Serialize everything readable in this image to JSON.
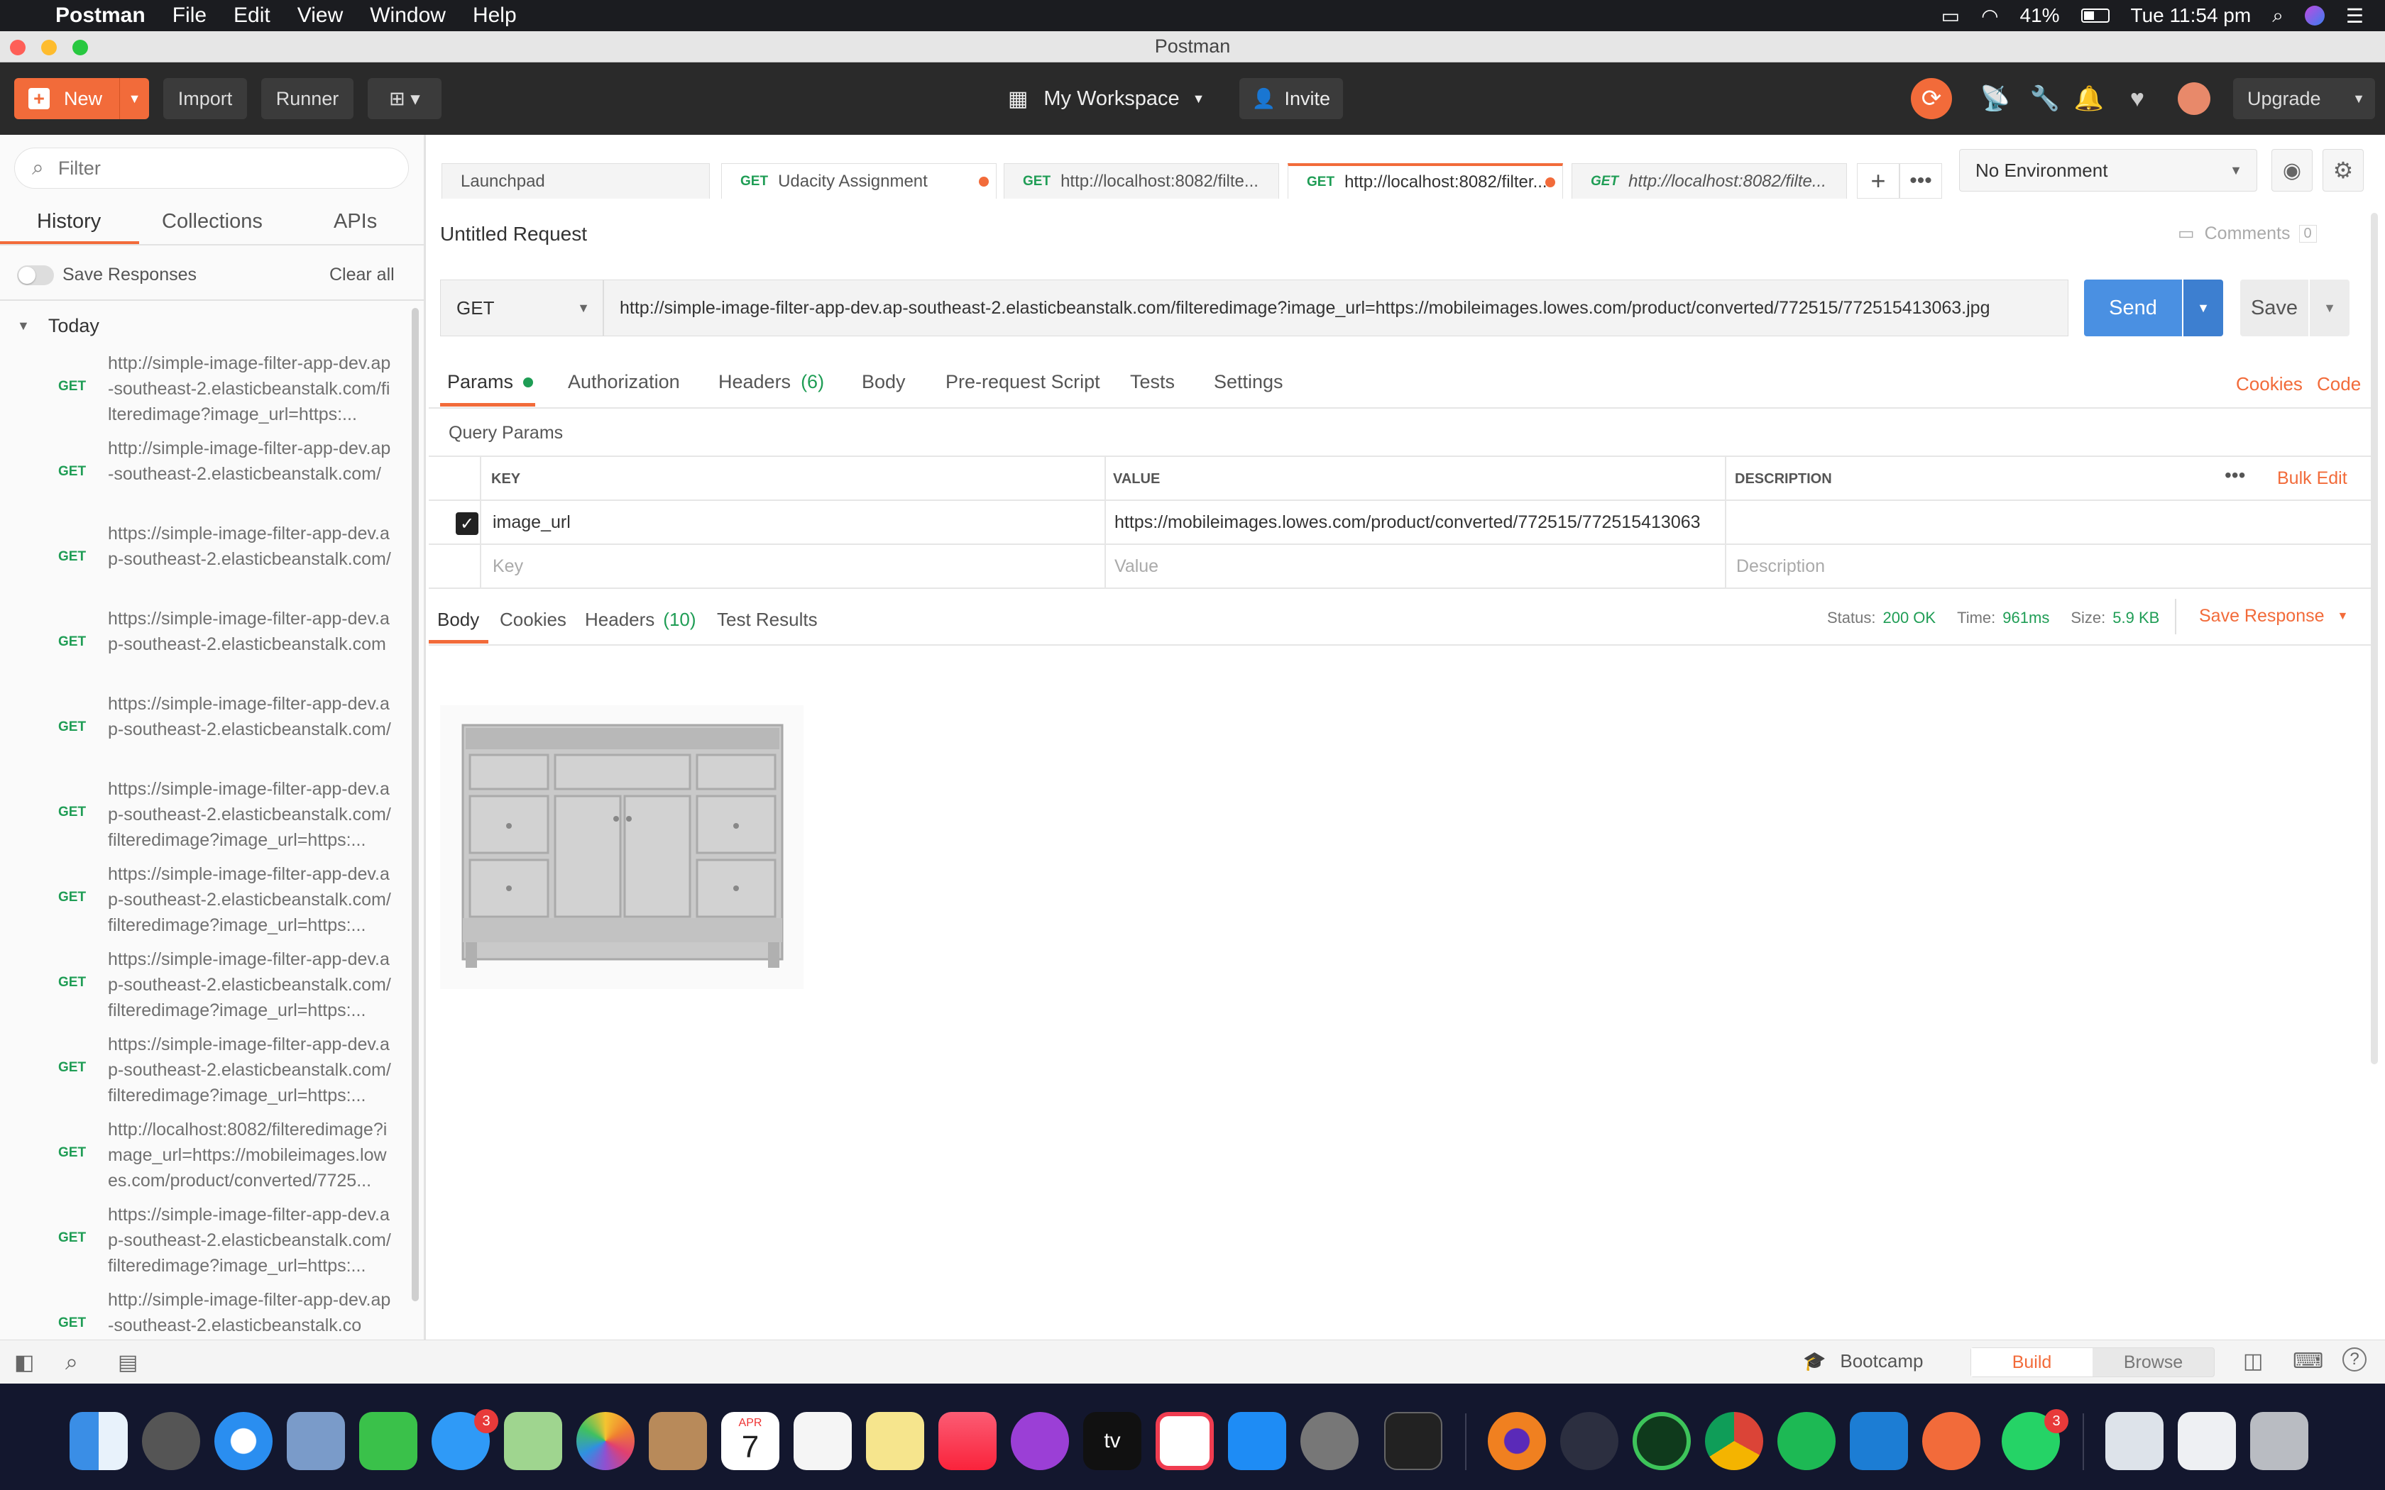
{
  "menubar": {
    "apple": "",
    "items": [
      "Postman",
      "File",
      "Edit",
      "View",
      "Window",
      "Help"
    ],
    "battery": "41%",
    "clock": "Tue 11:54 pm"
  },
  "window": {
    "title": "Postman"
  },
  "header": {
    "new_label": "New",
    "import_label": "Import",
    "runner_label": "Runner",
    "workspace_label": "My Workspace",
    "invite_label": "Invite",
    "upgrade_label": "Upgrade"
  },
  "sidebar": {
    "filter_placeholder": "Filter",
    "tabs": [
      "History",
      "Collections",
      "APIs"
    ],
    "save_responses": "Save Responses",
    "clear_all": "Clear all",
    "group": "Today",
    "items": [
      {
        "method": "GET",
        "url": "http://simple-image-filter-app-dev.ap-southeast-2.elasticbeanstalk.com/filteredimage?image_url=https:..."
      },
      {
        "method": "GET",
        "url": "http://simple-image-filter-app-dev.ap-southeast-2.elasticbeanstalk.com/"
      },
      {
        "method": "GET",
        "url": "https://simple-image-filter-app-dev.ap-southeast-2.elasticbeanstalk.com/"
      },
      {
        "method": "GET",
        "url": "https://simple-image-filter-app-dev.ap-southeast-2.elasticbeanstalk.com"
      },
      {
        "method": "GET",
        "url": "https://simple-image-filter-app-dev.ap-southeast-2.elasticbeanstalk.com/"
      },
      {
        "method": "GET",
        "url": "https://simple-image-filter-app-dev.ap-southeast-2.elasticbeanstalk.com/filteredimage?image_url=https:..."
      },
      {
        "method": "GET",
        "url": "https://simple-image-filter-app-dev.ap-southeast-2.elasticbeanstalk.com/filteredimage?image_url=https:..."
      },
      {
        "method": "GET",
        "url": "https://simple-image-filter-app-dev.ap-southeast-2.elasticbeanstalk.com/filteredimage?image_url=https:..."
      },
      {
        "method": "GET",
        "url": "https://simple-image-filter-app-dev.ap-southeast-2.elasticbeanstalk.com/filteredimage?image_url=https:..."
      },
      {
        "method": "GET",
        "url": "http://localhost:8082/filteredimage?image_url=https://mobileimages.lowes.com/product/converted/7725..."
      },
      {
        "method": "GET",
        "url": "https://simple-image-filter-app-dev.ap-southeast-2.elasticbeanstalk.com/filteredimage?image_url=https:..."
      },
      {
        "method": "GET",
        "url": "http://simple-image-filter-app-dev.ap-southeast-2.elasticbeanstalk.co"
      }
    ]
  },
  "tabs": [
    {
      "method": "",
      "label": "Launchpad"
    },
    {
      "method": "GET",
      "label": "Udacity Assignment"
    },
    {
      "method": "GET",
      "label": "http://localhost:8082/filte..."
    },
    {
      "method": "GET",
      "label": "http://localhost:8082/filter..."
    },
    {
      "method": "GET",
      "label": "http://localhost:8082/filte..."
    }
  ],
  "environment": {
    "selected": "No Environment"
  },
  "request": {
    "name": "Untitled Request",
    "comments_label": "Comments",
    "comments_count": "0",
    "method": "GET",
    "url": "http://simple-image-filter-app-dev.ap-southeast-2.elasticbeanstalk.com/filteredimage?image_url=https://mobileimages.lowes.com/product/converted/772515/772515413063.jpg",
    "send_label": "Send",
    "save_label": "Save",
    "subtabs": {
      "params": "Params",
      "authorization": "Authorization",
      "headers": "Headers",
      "headers_count": "(6)",
      "body": "Body",
      "prerequest": "Pre-request Script",
      "tests": "Tests",
      "settings": "Settings"
    },
    "cookies_link": "Cookies",
    "code_link": "Code"
  },
  "params": {
    "title": "Query Params",
    "col_key": "KEY",
    "col_value": "VALUE",
    "col_description": "DESCRIPTION",
    "bulk_edit": "Bulk Edit",
    "row": {
      "key": "image_url",
      "value": "https://mobileimages.lowes.com/product/converted/772515/772515413063"
    },
    "placeholder_key": "Key",
    "placeholder_value": "Value",
    "placeholder_description": "Description"
  },
  "response": {
    "tabs": {
      "body": "Body",
      "cookies": "Cookies",
      "headers": "Headers",
      "headers_count": "(10)",
      "tests": "Test Results"
    },
    "status_label": "Status:",
    "status_value": "200 OK",
    "time_label": "Time:",
    "time_value": "961ms",
    "size_label": "Size:",
    "size_value": "5.9 KB",
    "save_response": "Save Response"
  },
  "statusbar": {
    "bootcamp": "Bootcamp",
    "build": "Build",
    "browse": "Browse"
  },
  "dock": {
    "messages_badge": "3",
    "calendar_month": "APR",
    "calendar_day": "7",
    "whatsapp_badge": "3",
    "appletv_label": "tv"
  },
  "colors": {
    "accent_orange": "#f26b3a",
    "send_blue": "#4a90e2",
    "get_green": "#1f9d55",
    "dark_header": "#2a2a2a"
  }
}
